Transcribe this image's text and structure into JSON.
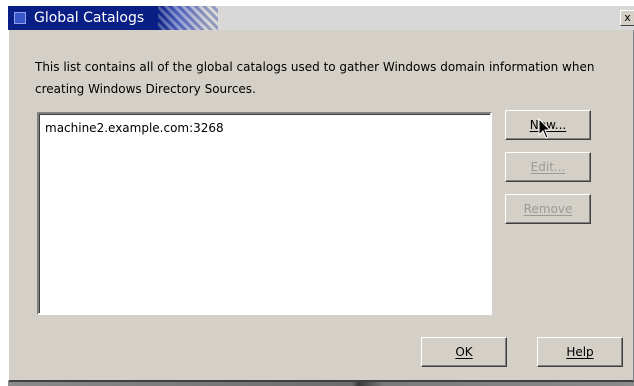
{
  "window": {
    "title": "Global Catalogs",
    "close_glyph": "x"
  },
  "description": "This list contains all of the global catalogs used to gather Windows domain information when creating Windows Directory Sources.",
  "catalog_list": {
    "items": [
      "machine2.example.com:3268"
    ]
  },
  "buttons": {
    "new": {
      "label": "New...",
      "enabled": true
    },
    "edit": {
      "label": "Edit...",
      "enabled": false
    },
    "remove": {
      "label": "Remove",
      "enabled": false
    },
    "ok": {
      "label": "OK",
      "enabled": true
    },
    "help": {
      "label": "Help",
      "enabled": true
    }
  },
  "colors": {
    "titlebar_active": "#0a1f86",
    "dialog_background": "#d4d0c8",
    "disabled_text": "#9a9a9a"
  },
  "icons": {
    "window_icon": "window-icon",
    "close_icon": "close-icon",
    "cursor": "mouse-pointer-icon"
  }
}
